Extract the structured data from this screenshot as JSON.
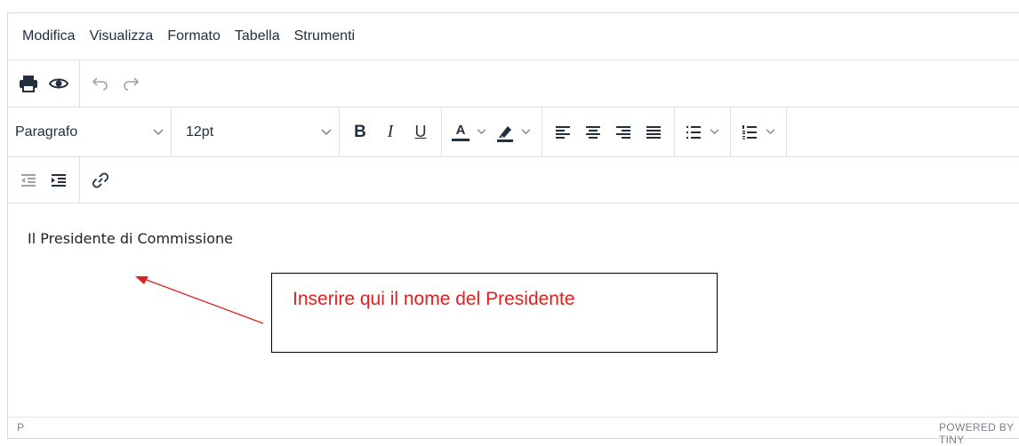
{
  "menubar": {
    "items": [
      "Modifica",
      "Visualizza",
      "Formato",
      "Tabella",
      "Strumenti"
    ]
  },
  "toolbar": {
    "print_icon": "printer-icon",
    "preview_icon": "eye-icon",
    "undo_icon": "undo-icon",
    "redo_icon": "redo-icon",
    "block_format": "Paragrafo",
    "font_size": "12pt",
    "bold_label": "B",
    "italic_label": "I",
    "underline_label": "U",
    "text_color_label": "A",
    "text_color_bar": "#222f3e",
    "highlight_bar": "#222f3e"
  },
  "content": {
    "text": "Il Presidente di Commissione"
  },
  "statusbar": {
    "path": "P",
    "brand": "POWERED BY TINY"
  },
  "annotation": {
    "text": "Inserire qui il nome del Presidente",
    "color": "#e02020"
  }
}
